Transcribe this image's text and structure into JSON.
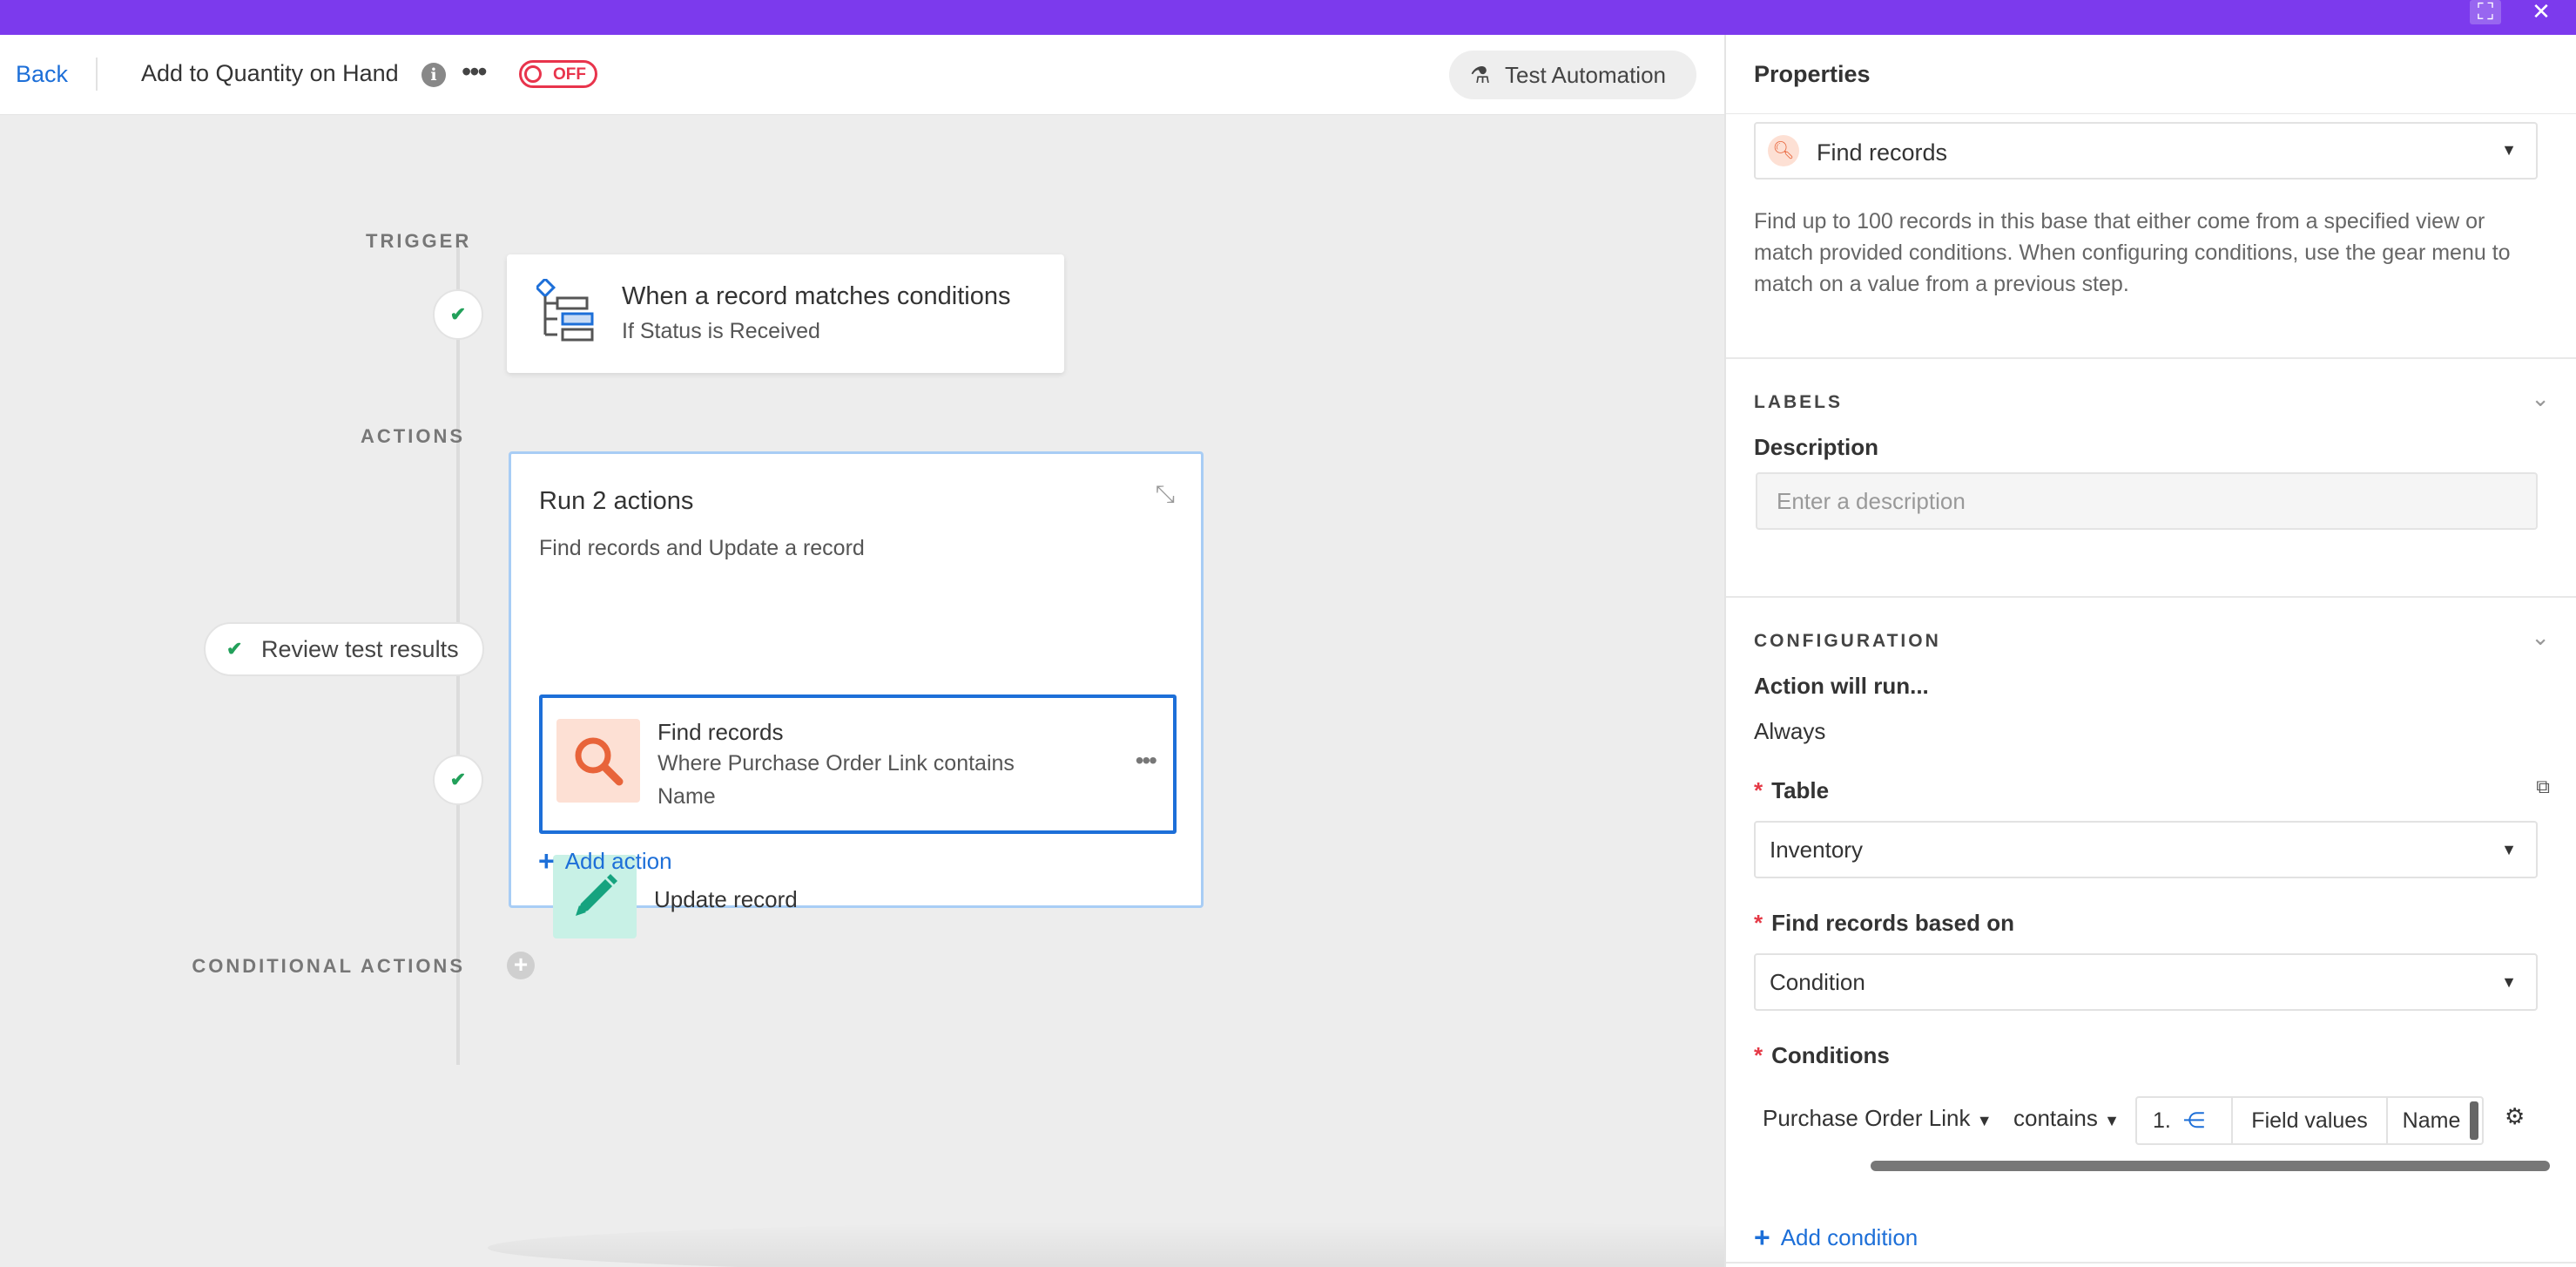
{
  "header": {
    "back_label": "Back",
    "automation_title": "Add to Quantity on Hand",
    "toggle_label": "OFF",
    "test_button_label": "Test Automation"
  },
  "canvas": {
    "trigger_label": "TRIGGER",
    "trigger": {
      "title": "When a record matches conditions",
      "subtitle": "If Status is Received"
    },
    "actions_label": "ACTIONS",
    "run_group": {
      "title": "Run 2 actions",
      "subtitle": "Find records and Update a record",
      "actions": [
        {
          "title": "Find records",
          "desc_line1": "Where Purchase Order Link contains",
          "desc_line2": "Name",
          "icon": "search-icon",
          "tile_color": "#fde0d4"
        },
        {
          "title": "Update record",
          "icon": "pencil-icon",
          "tile_color": "#c8f1e6"
        }
      ],
      "add_action_label": "Add action"
    },
    "review_label": "Review test results",
    "conditional_label": "CONDITIONAL ACTIONS"
  },
  "panel": {
    "title": "Properties",
    "action_type": "Find records",
    "description": "Find up to 100 records in this base that either come from a specified view or match provided conditions. When configuring conditions, use the gear menu to match on a value from a previous step.",
    "labels_section": {
      "title": "LABELS",
      "description_label": "Description",
      "description_placeholder": "Enter a description"
    },
    "configuration_section": {
      "title": "CONFIGURATION",
      "action_will_run_label": "Action will run...",
      "action_will_run_value": "Always",
      "table_label": "Table",
      "table_value": "Inventory",
      "find_based_on_label": "Find records based on",
      "find_based_on_value": "Condition",
      "conditions_label": "Conditions",
      "condition": {
        "field": "Purchase Order Link",
        "operator": "contains",
        "step_ref": "1.",
        "value_source": "Field values",
        "value_field": "Name"
      },
      "add_condition_label": "Add condition"
    }
  },
  "colors": {
    "topbar": "#7c3aed",
    "link": "#1d6fd8",
    "toggle_off": "#e8344c",
    "success": "#22a05a",
    "selected_border": "#1d6fd8"
  }
}
